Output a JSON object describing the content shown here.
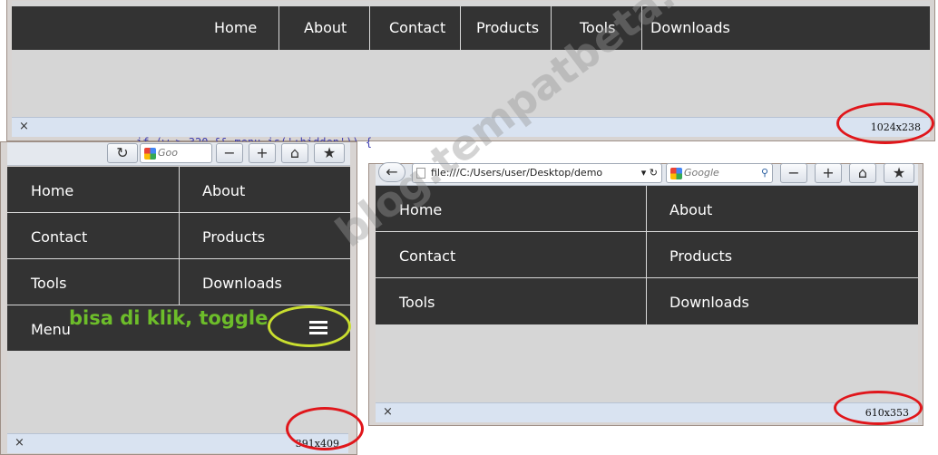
{
  "watermark": "blog.tempatbeta.com",
  "code_snippet": "if (w > 320 && menu.is(':hidden')) {",
  "wide_window": {
    "nav_items": [
      "Home",
      "About",
      "Contact",
      "Products",
      "Tools",
      "Downloads"
    ],
    "status": {
      "close": "×",
      "size": "1024x238"
    }
  },
  "narrow_window": {
    "search_text": "Goo",
    "nav_items": [
      "Home",
      "About",
      "Contact",
      "Products",
      "Tools",
      "Downloads"
    ],
    "menu_label": "Menu",
    "annotation": "bisa di klik, toggle",
    "status": {
      "close": "×",
      "size": "391x409"
    }
  },
  "medium_window": {
    "url": "file:///C:/Users/user/Desktop/demo",
    "search_placeholder": "Google",
    "nav_items": [
      "Home",
      "About",
      "Contact",
      "Products",
      "Tools",
      "Downloads"
    ],
    "status": {
      "close": "×",
      "size": "610x353"
    }
  },
  "icons": {
    "back": "back-arrow-icon",
    "reload": "reload-icon",
    "zoom_out": "zoom-out-icon",
    "zoom_in": "zoom-in-icon",
    "home": "home-icon",
    "bookmark": "bookmark-icon",
    "search": "magnifier-icon",
    "menu": "hamburger-icon"
  },
  "colors": {
    "navbar": "#333333",
    "viewport": "#d6d6d6",
    "statusbar": "#d9e3f1",
    "highlight_circle": "#e0161b",
    "annotation": "#6dbd2a"
  }
}
